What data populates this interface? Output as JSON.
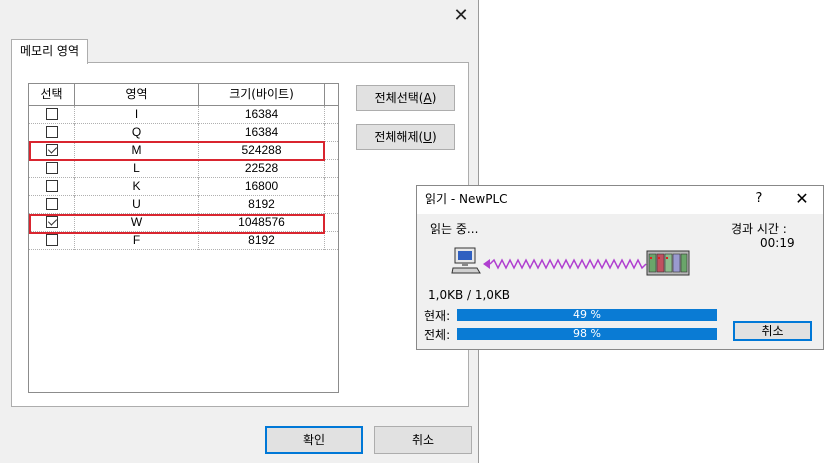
{
  "main_dialog": {
    "tab_label": "메모리 영역",
    "columns": [
      "선택",
      "영역",
      "크기(바이트)"
    ],
    "rows": [
      {
        "area": "I",
        "size": "16384",
        "checked": false
      },
      {
        "area": "Q",
        "size": "16384",
        "checked": false
      },
      {
        "area": "M",
        "size": "524288",
        "checked": true
      },
      {
        "area": "L",
        "size": "22528",
        "checked": false
      },
      {
        "area": "K",
        "size": "16800",
        "checked": false
      },
      {
        "area": "U",
        "size": "8192",
        "checked": false
      },
      {
        "area": "W",
        "size": "1048576",
        "checked": true
      },
      {
        "area": "F",
        "size": "8192",
        "checked": false
      }
    ],
    "select_all": {
      "label": "전체선택(",
      "key": "A",
      "end": ")"
    },
    "deselect_all": {
      "label": "전체해제(",
      "key": "U",
      "end": ")"
    },
    "ok_label": "확인",
    "cancel_label": "취소"
  },
  "progress_dialog": {
    "title": "읽기 - NewPLC",
    "help": "?",
    "status": "읽는 중...",
    "elapsed_label": "경과 시간 :",
    "elapsed_value": "00:19",
    "transfer": "1,0KB / 1,0KB",
    "current_label": "현재:",
    "current_text": "49 %",
    "current_fraction": 1.0,
    "total_label": "전체:",
    "total_text": "98 %",
    "total_fraction": 1.0,
    "cancel_label": "취소"
  },
  "colors": {
    "highlight": "#d9252f",
    "progress": "#0a7bd4",
    "signal": "#b040d0"
  }
}
